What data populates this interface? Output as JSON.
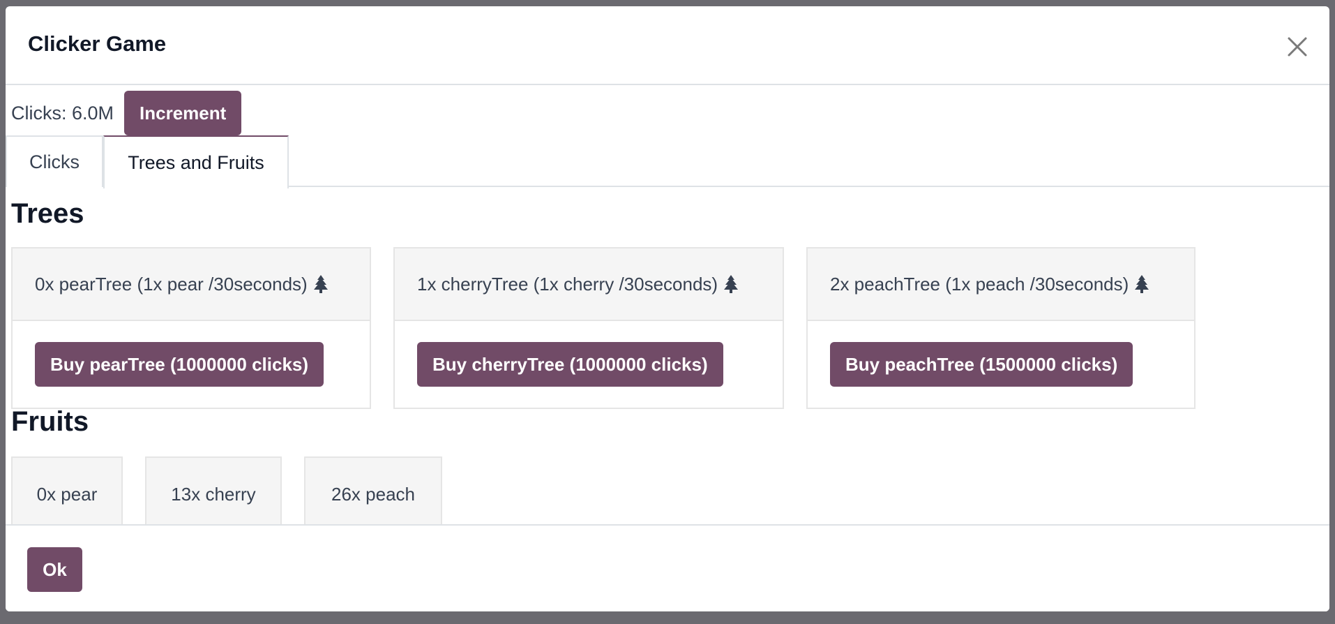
{
  "dialog": {
    "title": "Clicker Game",
    "close_icon": "close-icon"
  },
  "counter": {
    "clicks_label": "Clicks: 6.0M",
    "increment_label": "Increment"
  },
  "tabs": [
    {
      "label": "Clicks",
      "active": false
    },
    {
      "label": "Trees and Fruits",
      "active": true
    }
  ],
  "trees": {
    "heading": "Trees",
    "items": [
      {
        "name": "pearTree",
        "description": "0x pearTree (1x pear /30seconds)",
        "icon": "tree-icon",
        "buy_label": "Buy pearTree (1000000 clicks)"
      },
      {
        "name": "cherryTree",
        "description": "1x cherryTree (1x cherry /30seconds)",
        "icon": "tree-icon",
        "buy_label": "Buy cherryTree (1000000 clicks)"
      },
      {
        "name": "peachTree",
        "description": "2x peachTree (1x peach /30seconds)",
        "icon": "tree-icon",
        "buy_label": "Buy peachTree (1500000 clicks)"
      }
    ]
  },
  "fruits": {
    "heading": "Fruits",
    "items": [
      {
        "label": "0x pear"
      },
      {
        "label": "13x cherry"
      },
      {
        "label": "26x peach"
      }
    ]
  },
  "footer": {
    "ok_label": "Ok"
  },
  "colors": {
    "primary": "#714b67",
    "backdrop": "#6b6a70",
    "card_header_bg": "#f5f5f5",
    "icon_color": "#374151"
  }
}
